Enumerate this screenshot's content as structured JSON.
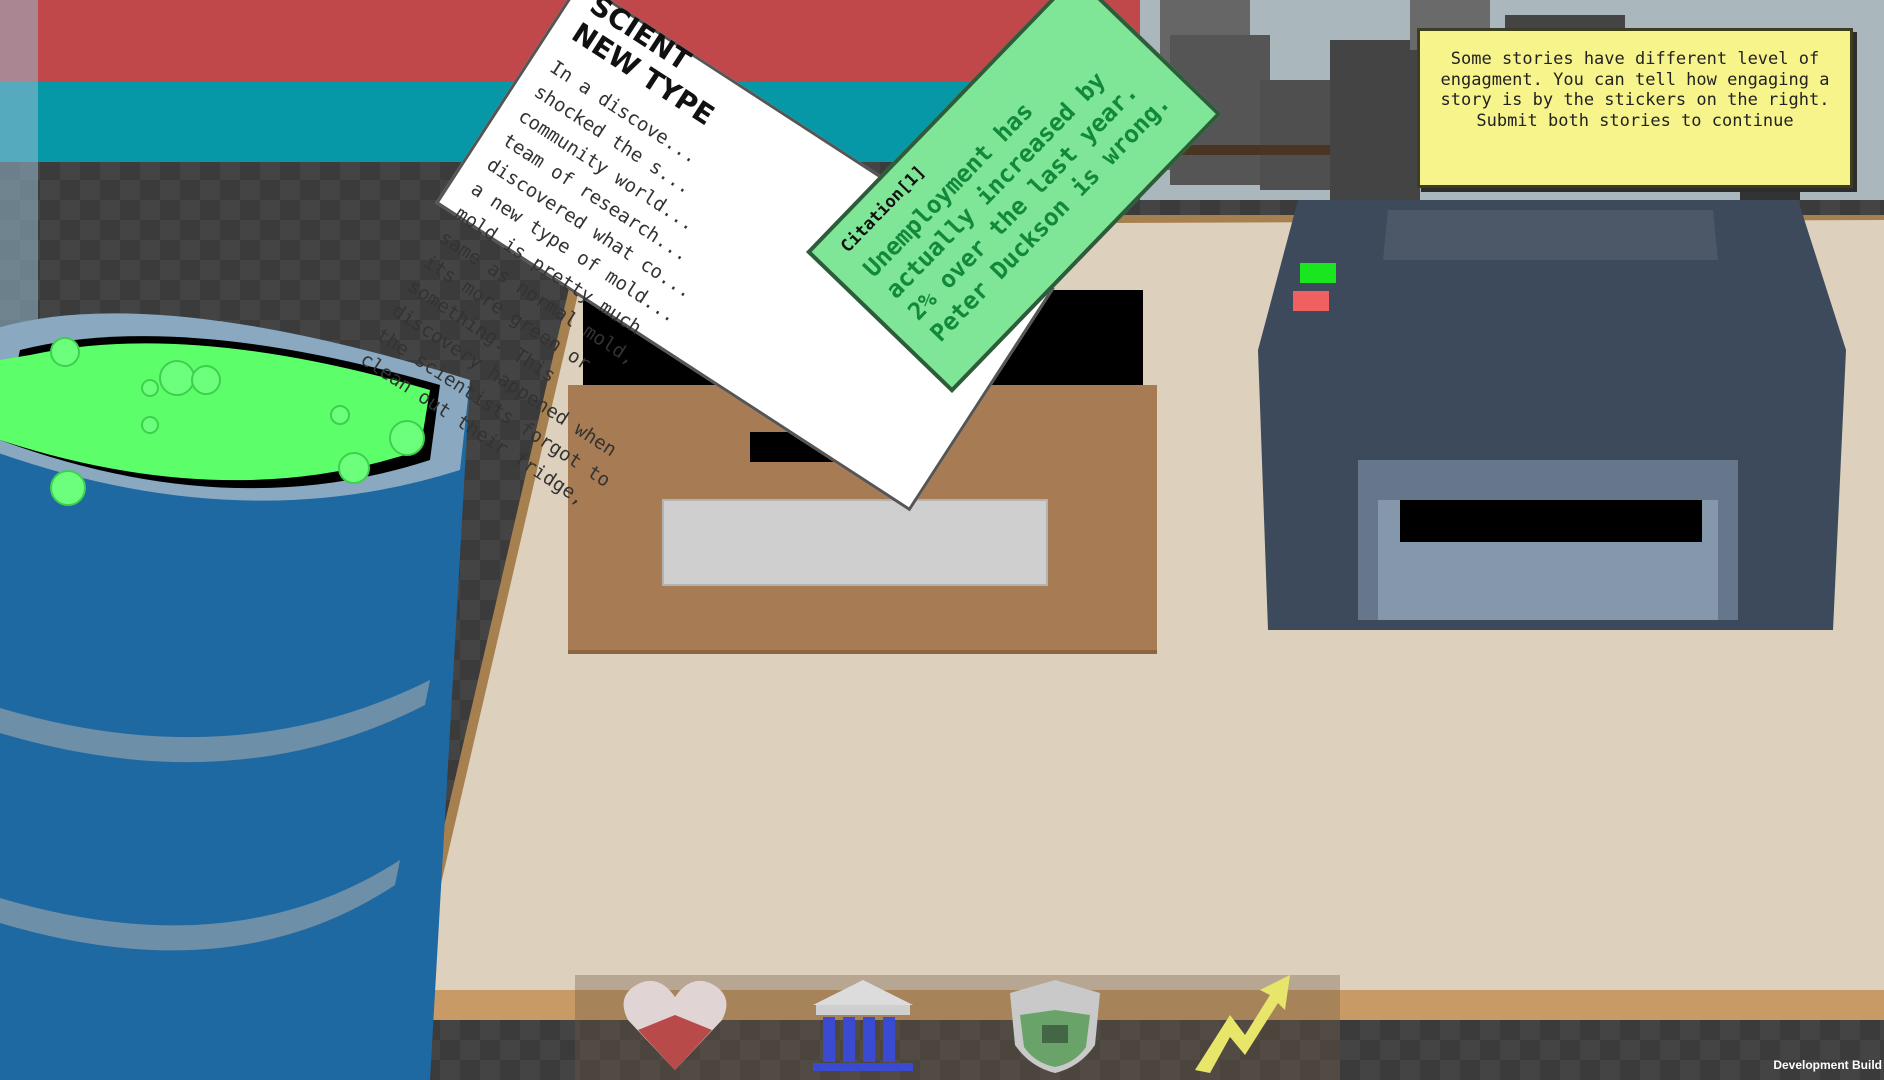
{
  "tooltip": {
    "text": "Some stories have different level of engagment.  You can tell how engaging a story is by the stickers on the right. Submit both stories to continue"
  },
  "story_paper": {
    "headline_line1": "SCIENT",
    "headline_line2": "NEW TYPE",
    "body": "In a discove...\nshocked the s...\ncommunity world...\nteam of research...\ndiscovered what co...\na new type of mold...\nmold is pretty much\nsame as normal mold,\nits more green or\nsomething. This\ndiscovery happened when\nthe scientists forgot to\nclean out their fridge,"
  },
  "citation_card": {
    "label": "Citation[1]",
    "text": "Unemployment has actually increased by 2% over the last year. Peter Duckson is wrong."
  },
  "printer": {
    "led_green": "#19e61e",
    "led_red": "#f06060"
  },
  "toolbar": {
    "tools": [
      {
        "name": "heart-handshake-icon",
        "color": "#b94a4a"
      },
      {
        "name": "government-building-icon",
        "color": "#3b4bd1"
      },
      {
        "name": "briefcase-shield-icon",
        "color": "#6aa36a"
      },
      {
        "name": "lightning-arrow-icon",
        "color": "#e8e66a"
      }
    ]
  },
  "footer": {
    "build_label": "Development Build"
  },
  "colors": {
    "goo": "#5cff6a",
    "barrel": "#1f69a3",
    "table": "#ddd0bc",
    "box": "#a77b53"
  }
}
